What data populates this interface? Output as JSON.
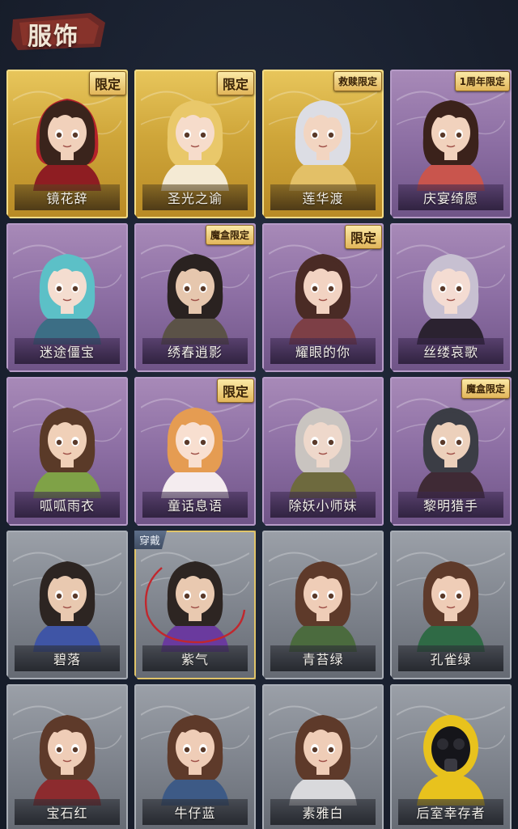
{
  "header": {
    "title": "服饰"
  },
  "cards": [
    {
      "name": "镜花辞",
      "tier": "gold",
      "badge": "限定",
      "hood": "#b4222a",
      "hair": "#3a241c",
      "cloth": "#8e1d22",
      "skin": "#f1d1bb"
    },
    {
      "name": "圣光之谕",
      "tier": "gold",
      "badge": "限定",
      "hood": "",
      "hair": "#e9c86a",
      "cloth": "#f4ead4",
      "skin": "#f6dccb"
    },
    {
      "name": "莲华渡",
      "tier": "gold",
      "badge": "救赎限定",
      "hood": "",
      "hair": "#dcdde4",
      "cloth": "#e3c067",
      "skin": "#f2d5c1"
    },
    {
      "name": "庆宴绮愿",
      "tier": "purple",
      "badge": "1周年限定",
      "hood": "",
      "hair": "#3b221b",
      "cloth": "#c9554d",
      "skin": "#f1d2bd"
    },
    {
      "name": "迷途僵宝",
      "tier": "purple",
      "badge": "",
      "hood": "",
      "hair": "#5cc0c7",
      "cloth": "#3c6e85",
      "skin": "#f4ddd0"
    },
    {
      "name": "绣春逍影",
      "tier": "purple",
      "badge": "魔盒限定",
      "hood": "",
      "hair": "#2a2220",
      "cloth": "#5b5247",
      "skin": "#e6c7ae"
    },
    {
      "name": "耀眼的你",
      "tier": "purple",
      "badge": "限定",
      "hood": "",
      "hair": "#4a2b25",
      "cloth": "#7d3f46",
      "skin": "#f2d3c2"
    },
    {
      "name": "丝缕哀歌",
      "tier": "purple",
      "badge": "",
      "hood": "",
      "hair": "#c7c0d1",
      "cloth": "#2b2230",
      "skin": "#f4dcd2"
    },
    {
      "name": "呱呱雨衣",
      "tier": "purple",
      "badge": "",
      "hood": "",
      "hair": "#5a3a28",
      "cloth": "#7fa247",
      "skin": "#f0d0b8"
    },
    {
      "name": "童话息语",
      "tier": "purple",
      "badge": "限定",
      "hood": "",
      "hair": "#e59c52",
      "cloth": "#f4ecef",
      "skin": "#f8dfd0"
    },
    {
      "name": "除妖小师妹",
      "tier": "purple",
      "badge": "",
      "hood": "",
      "hair": "#c9c4c0",
      "cloth": "#6e6a3e",
      "skin": "#eed8cb"
    },
    {
      "name": "黎明猎手",
      "tier": "purple",
      "badge": "魔盒限定",
      "hood": "",
      "hair": "#3b3d45",
      "cloth": "#3f2a35",
      "skin": "#ecd0bb"
    },
    {
      "name": "碧落",
      "tier": "gray",
      "badge": "",
      "hood": "",
      "hair": "#2d2522",
      "cloth": "#3f55a6",
      "skin": "#e9c9b0"
    },
    {
      "name": "紫气",
      "tier": "gray",
      "badge": "",
      "hood": "",
      "hair": "#2d2522",
      "cloth": "#6a3a9e",
      "skin": "#e9c9b0",
      "wearing": "穿戴",
      "selected": true
    },
    {
      "name": "青苔绿",
      "tier": "gray",
      "badge": "",
      "hood": "",
      "hair": "#5e3a2a",
      "cloth": "#4b6b3e",
      "skin": "#efcdb7"
    },
    {
      "name": "孔雀绿",
      "tier": "gray",
      "badge": "",
      "hood": "",
      "hair": "#5e3a2a",
      "cloth": "#2f6a45",
      "skin": "#efcdb7"
    },
    {
      "name": "宝石红",
      "tier": "gray",
      "badge": "",
      "hood": "",
      "hair": "#5e3a2a",
      "cloth": "#8c2b2e",
      "skin": "#efcdb7"
    },
    {
      "name": "牛仔蓝",
      "tier": "gray",
      "badge": "",
      "hood": "",
      "hair": "#5e3a2a",
      "cloth": "#3d5a86",
      "skin": "#efcdb7"
    },
    {
      "name": "素雅白",
      "tier": "gray",
      "badge": "",
      "hood": "",
      "hair": "#5e3a2a",
      "cloth": "#d9d9dc",
      "skin": "#efcdb7"
    },
    {
      "name": "后室幸存者",
      "tier": "gray",
      "badge": "",
      "hood": "",
      "hair": "#1d1d22",
      "cloth": "#e8c21d",
      "skin": "#2a2a30",
      "mask": true
    }
  ]
}
